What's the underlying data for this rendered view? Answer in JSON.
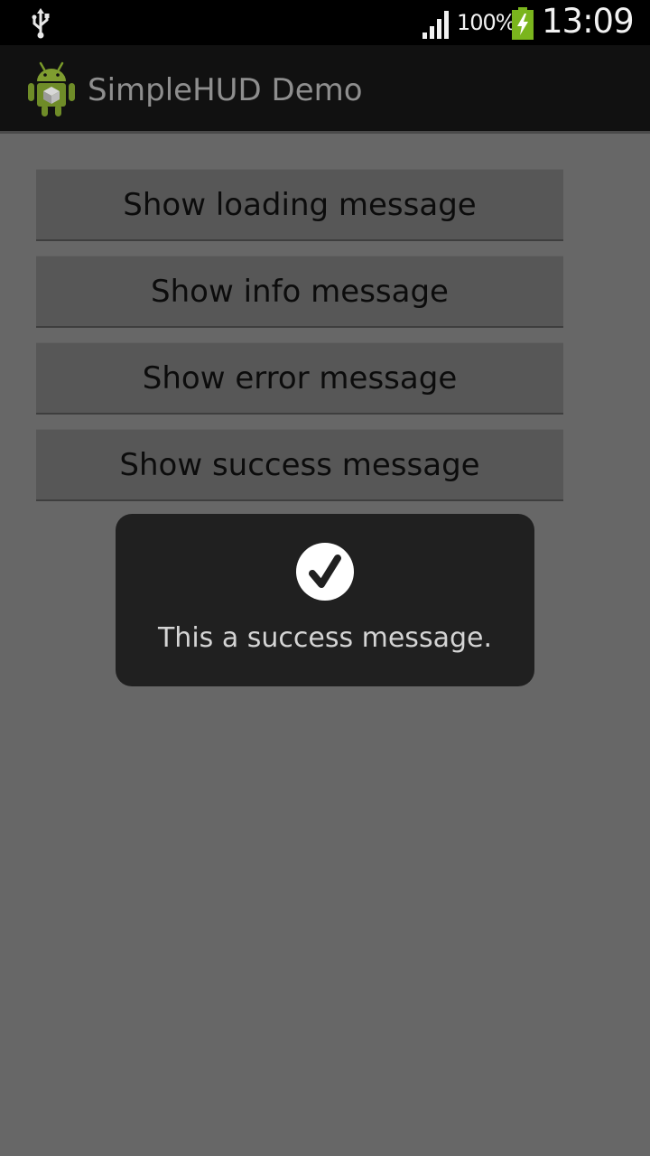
{
  "status_bar": {
    "battery_percent": "100%",
    "time": "13:09",
    "icons": [
      "usb-icon",
      "signal-icon",
      "battery-charging-icon"
    ]
  },
  "action_bar": {
    "title": "SimpleHUD Demo",
    "icon": "android-app-icon"
  },
  "buttons": [
    {
      "label": "Show loading message"
    },
    {
      "label": "Show info message"
    },
    {
      "label": "Show error message"
    },
    {
      "label": "Show success message"
    }
  ],
  "hud": {
    "icon": "checkmark-icon",
    "message": "This a success message."
  },
  "colors": {
    "background": "#676767",
    "action_bar": "#111111",
    "hud": "#202020",
    "battery_green": "#7ab51d",
    "android_green": "#a4c639"
  }
}
